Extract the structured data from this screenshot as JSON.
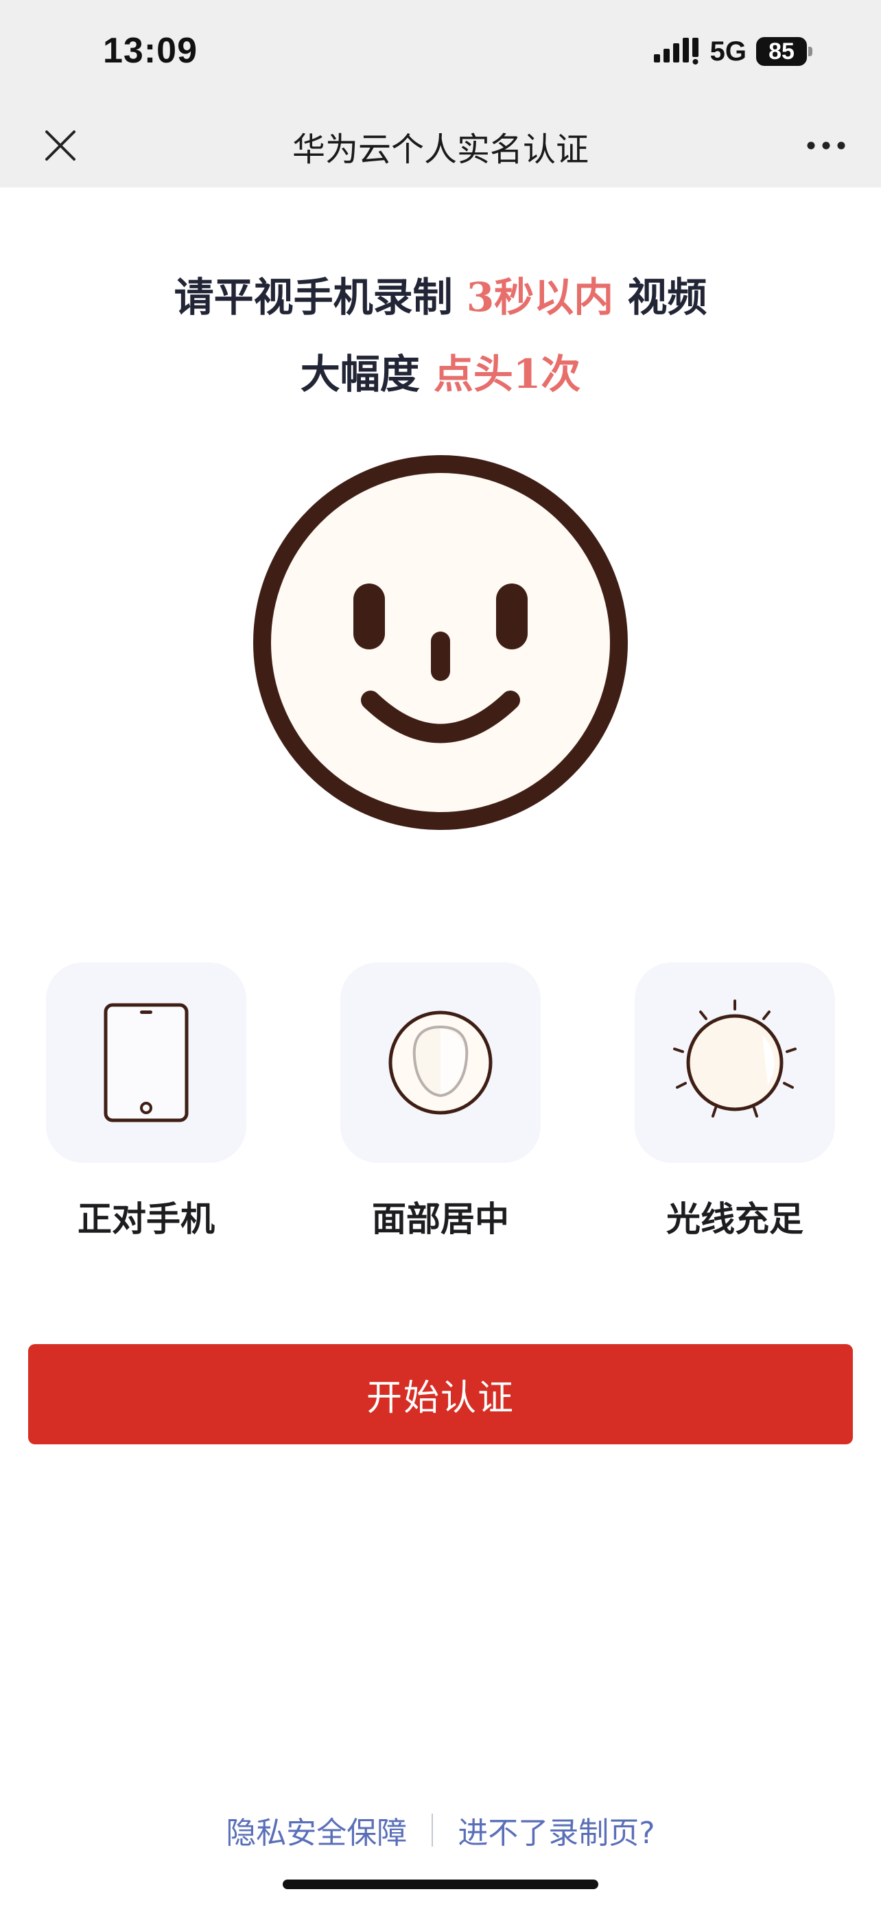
{
  "status_bar": {
    "time": "13:09",
    "network": "5G",
    "battery": "85"
  },
  "nav": {
    "title": "华为云个人实名认证",
    "close_icon": "close-icon",
    "more_icon": "more-icon"
  },
  "instruction": {
    "line1_prefix": "请平视手机录制",
    "line1_highlight": "3秒以内",
    "line1_suffix": "视频",
    "line2_prefix": "大幅度",
    "line2_highlight": "点头1次"
  },
  "face_icon": "smiley-face-icon",
  "tips": [
    {
      "icon": "phone-icon",
      "label": "正对手机"
    },
    {
      "icon": "face-outline-icon",
      "label": "面部居中"
    },
    {
      "icon": "sun-icon",
      "label": "光线充足"
    }
  ],
  "start_button": {
    "label": "开始认证"
  },
  "footer": {
    "privacy_link": "隐私安全保障",
    "help_link": "进不了录制页?"
  },
  "colors": {
    "accent_red": "#d62e24",
    "highlight_text": "#e76e6b",
    "face_brown": "#3f1f15",
    "link_blue": "#5a6fb8",
    "card_bg": "#f5f6fb"
  }
}
